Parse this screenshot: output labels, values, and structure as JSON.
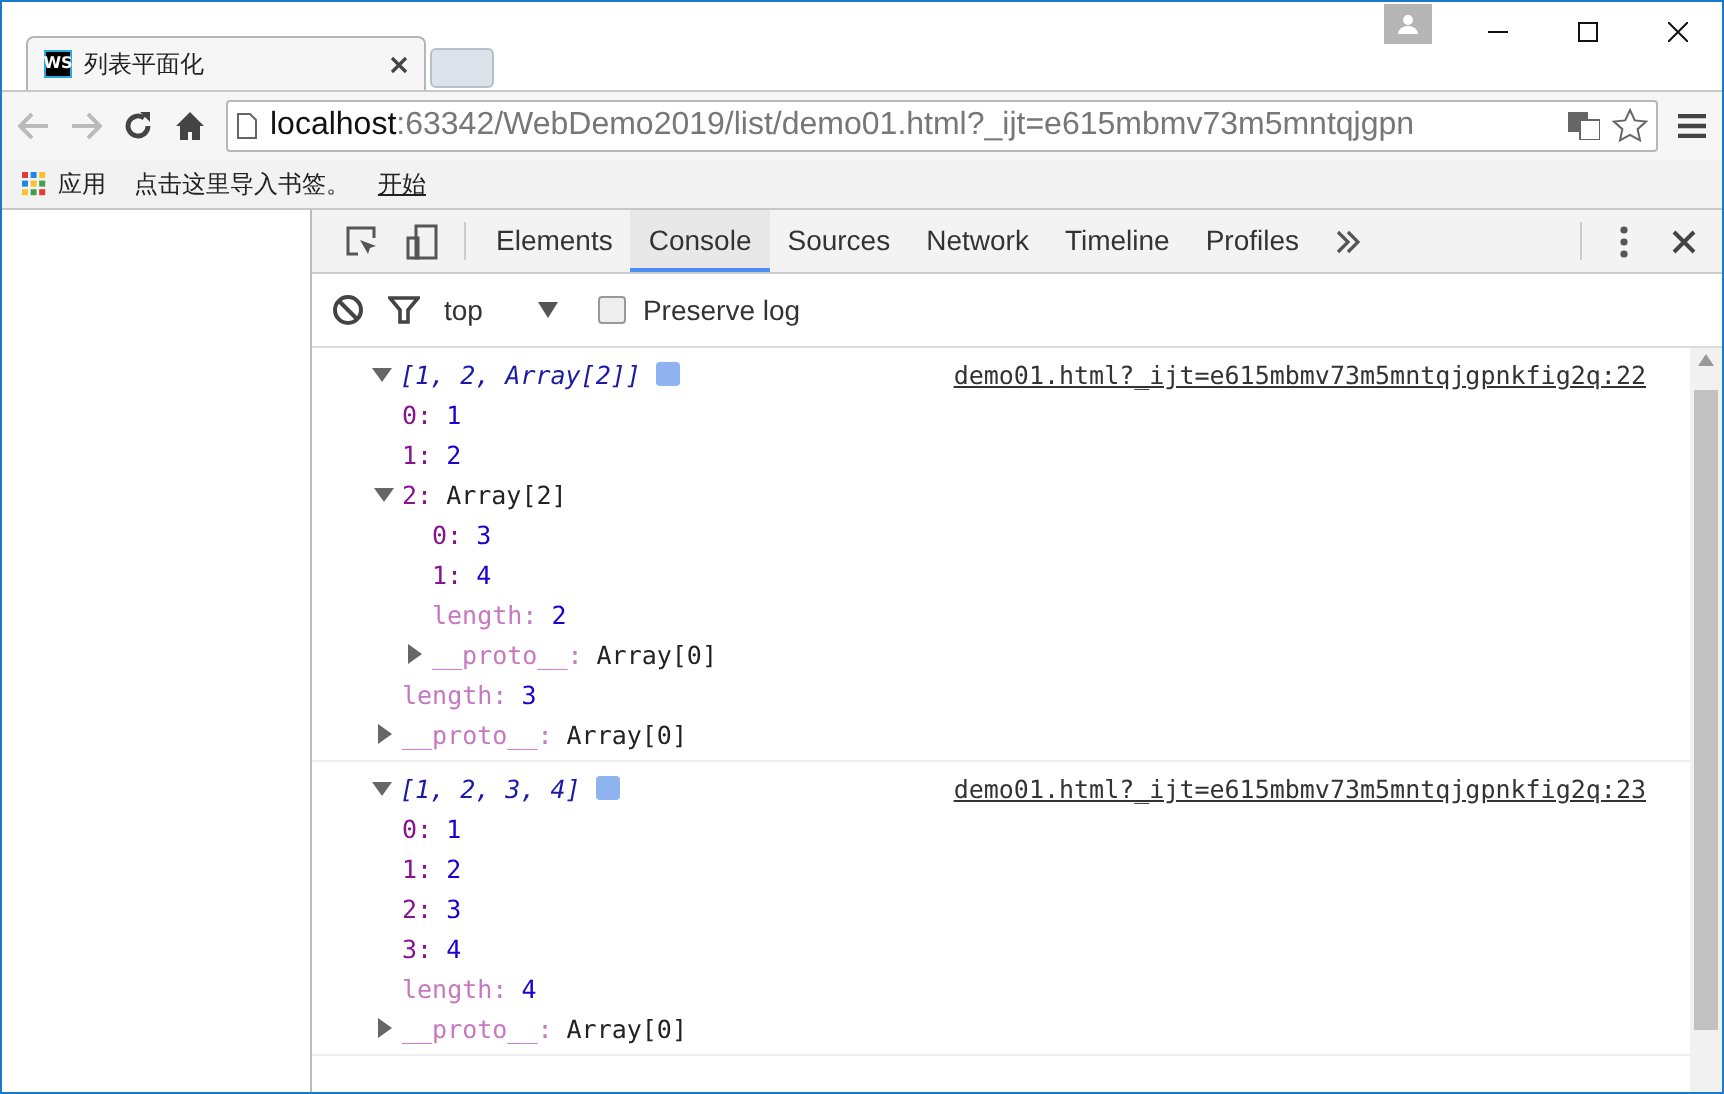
{
  "browser_tab": {
    "title": "列表平面化",
    "favicon": "WS",
    "selected": true
  },
  "address_bar": {
    "host": "localhost",
    "path": ":63342/WebDemo2019/list/demo01.html?_ijt=e615mbmv73m5mntqjgpn"
  },
  "bookmarks": [
    {
      "kind": "apps",
      "label": "应用"
    },
    {
      "kind": "text",
      "label": "点击这里导入书签。"
    },
    {
      "kind": "link",
      "label": "开始"
    }
  ],
  "devtools": {
    "tabs": [
      {
        "label": "Elements",
        "selected": false
      },
      {
        "label": "Console",
        "selected": true
      },
      {
        "label": "Sources",
        "selected": false
      },
      {
        "label": "Network",
        "selected": false
      },
      {
        "label": "Timeline",
        "selected": false
      },
      {
        "label": "Profiles",
        "selected": false
      }
    ],
    "context": "top",
    "preserve_log": {
      "label": "Preserve log",
      "checked": false
    }
  },
  "console": [
    {
      "preview": "[1, 2, Array[2]]",
      "expanded": true,
      "source": "demo01.html?_ijt=e615mbmv73m5mntqjgpnkfig2q:22",
      "children": [
        {
          "key": "0:",
          "value": "1",
          "kind": "item"
        },
        {
          "key": "1:",
          "value": "2",
          "kind": "item"
        },
        {
          "key": "2:",
          "value": "Array[2]",
          "kind": "subarray",
          "expanded": true,
          "children": [
            {
              "key": "0:",
              "value": "3",
              "kind": "item"
            },
            {
              "key": "1:",
              "value": "4",
              "kind": "item"
            },
            {
              "key": "length:",
              "value": "2",
              "kind": "length"
            },
            {
              "key": "__proto__:",
              "value": "Array[0]",
              "kind": "proto",
              "expanded": false
            }
          ]
        },
        {
          "key": "length:",
          "value": "3",
          "kind": "length"
        },
        {
          "key": "__proto__:",
          "value": "Array[0]",
          "kind": "proto",
          "expanded": false
        }
      ]
    },
    {
      "preview": "[1, 2, 3, 4]",
      "expanded": true,
      "source": "demo01.html?_ijt=e615mbmv73m5mntqjgpnkfig2q:23",
      "children": [
        {
          "key": "0:",
          "value": "1",
          "kind": "item"
        },
        {
          "key": "1:",
          "value": "2",
          "kind": "item"
        },
        {
          "key": "2:",
          "value": "3",
          "kind": "item"
        },
        {
          "key": "3:",
          "value": "4",
          "kind": "item"
        },
        {
          "key": "length:",
          "value": "4",
          "kind": "length"
        },
        {
          "key": "__proto__:",
          "value": "Array[0]",
          "kind": "proto",
          "expanded": false
        }
      ]
    }
  ]
}
